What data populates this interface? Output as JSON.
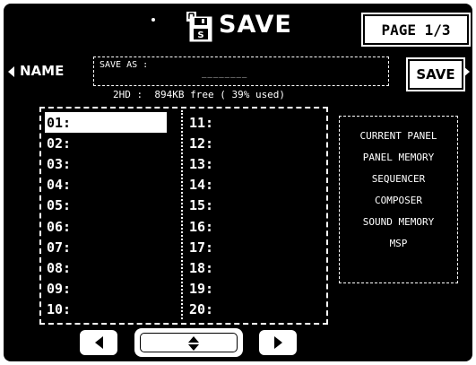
{
  "header": {
    "title": "SAVE",
    "page_label": "PAGE 1/3",
    "icon": "floppy-disk-icon"
  },
  "name_row": {
    "label": "NAME",
    "save_as_label": "SAVE AS :",
    "save_as_value": "________",
    "save_button": "SAVE"
  },
  "disk_info": "2HD :  894KB free ( 39% used)",
  "slots_left": [
    "01:",
    "02:",
    "03:",
    "04:",
    "05:",
    "06:",
    "07:",
    "08:",
    "09:",
    "10:"
  ],
  "slots_right": [
    "11:",
    "12:",
    "13:",
    "14:",
    "15:",
    "16:",
    "17:",
    "18:",
    "19:",
    "20:"
  ],
  "selected_slot": "01:",
  "data_types": [
    "CURRENT PANEL",
    "PANEL MEMORY",
    "SEQUENCER",
    "COMPOSER",
    "SOUND MEMORY",
    "MSP"
  ],
  "colors": {
    "background": "#000000",
    "foreground": "#ffffff"
  }
}
